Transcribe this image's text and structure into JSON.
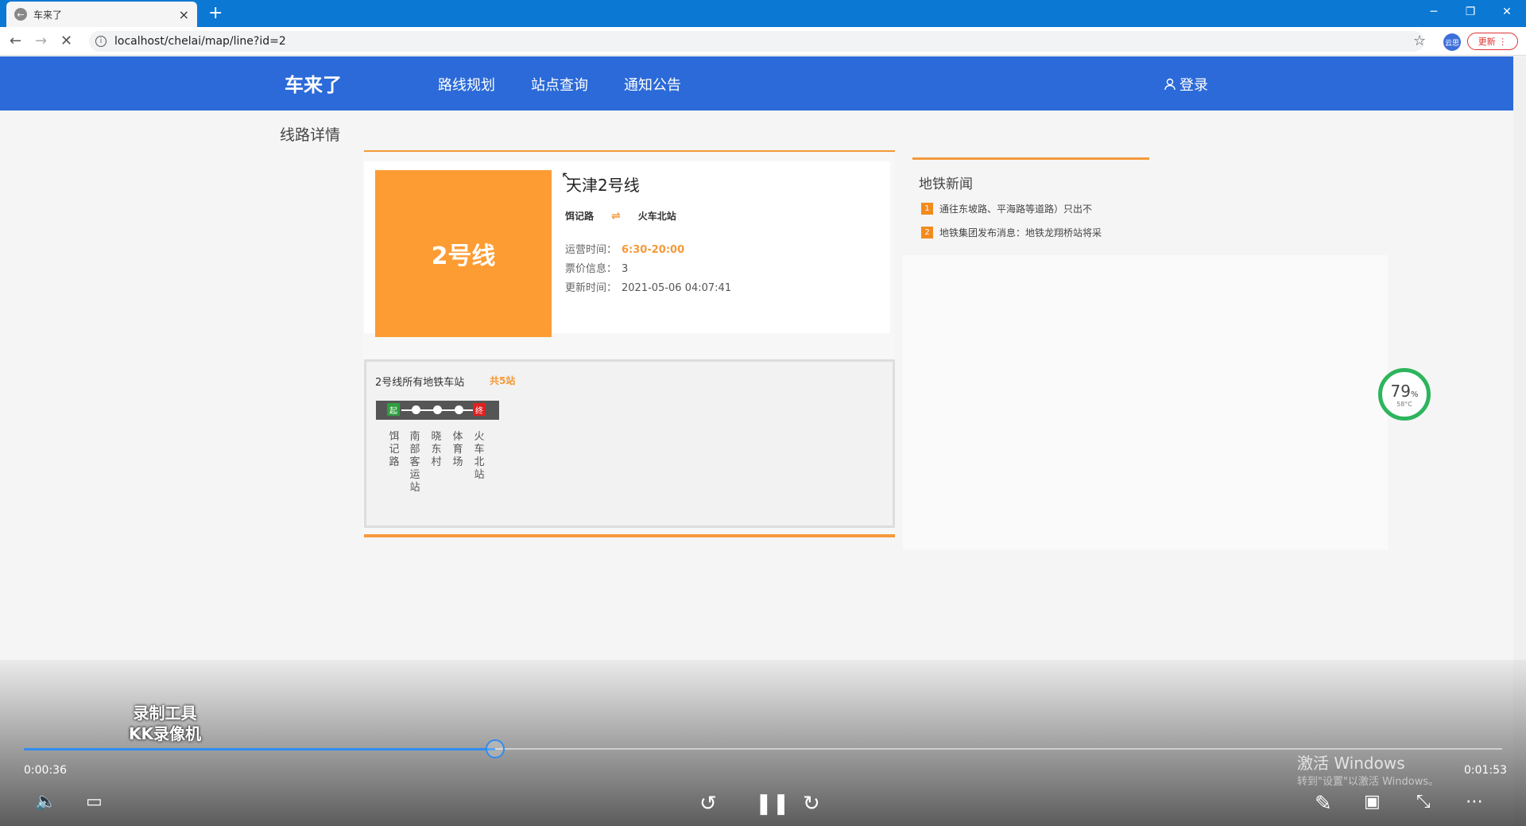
{
  "browser": {
    "tab_title": "车来了",
    "tab_close": "×",
    "new_tab": "+",
    "url": "localhost/chelai/map/line?id=2",
    "update_label": "更新",
    "profile_label": "云思"
  },
  "site": {
    "logo": "车来了",
    "nav": [
      "路线规划",
      "站点查询",
      "通知公告"
    ],
    "login": "登录",
    "breadcrumb": "线路详情"
  },
  "line": {
    "badge": "2号线",
    "title": "天津2号线",
    "start": "饵记路",
    "end": "火车北站",
    "hours_label": "运营时间：",
    "hours": "6:30-20:00",
    "fare_label": "票价信息：",
    "fare": "3",
    "updated_label": "更新时间：",
    "updated": "2021-05-06 04:07:41"
  },
  "stations": {
    "heading": "2号线所有地铁车站",
    "count": "共5站",
    "start_tag": "起",
    "end_tag": "终",
    "names": [
      "饵记路",
      "南部客运站",
      "晓东村",
      "体育场",
      "火车北站"
    ]
  },
  "news": {
    "title": "地铁新闻",
    "items": [
      {
        "num": "1",
        "text": "通往东坡路、平海路等道路）只出不"
      },
      {
        "num": "2",
        "text": "地铁集团发布消息：地铁龙翔桥站将采"
      }
    ]
  },
  "gauge": {
    "percent": "79",
    "unit": "%",
    "temp": "58°C"
  },
  "player": {
    "current_time": "0:00:36",
    "total_time": "0:01:53",
    "progress": 0.319,
    "watermark_line1": "录制工具",
    "watermark_line2": "KK录像机",
    "activate": "激活 Windows",
    "activate_sub": "转到\"设置\"以激活 Windows。"
  },
  "colors": {
    "brand": "#2b6ad8",
    "accent": "#f49a3a",
    "badge": "#fd9c33",
    "progress": "#2f8cf0"
  }
}
